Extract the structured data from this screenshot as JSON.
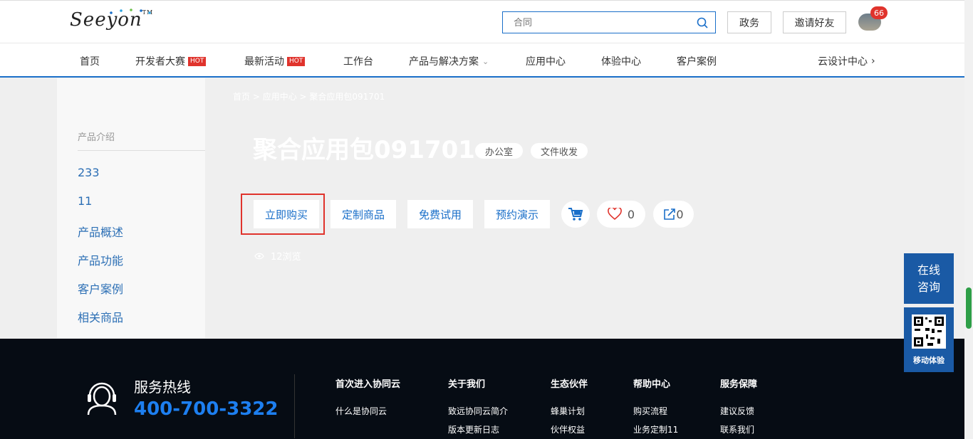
{
  "header": {
    "logo_text": "Seeyon",
    "logo_tm": "TM",
    "search_placeholder": "合同",
    "gov_button": "政务",
    "invite_button": "邀请好友",
    "notification_count": "66"
  },
  "nav": {
    "items": [
      {
        "label": "首页"
      },
      {
        "label": "开发者大赛",
        "badge": "HOT"
      },
      {
        "label": "最新活动",
        "badge": "HOT"
      },
      {
        "label": "工作台"
      },
      {
        "label": "产品与解决方案"
      },
      {
        "label": "应用中心"
      },
      {
        "label": "体验中心"
      },
      {
        "label": "客户案例"
      },
      {
        "label": "云设计中心"
      }
    ]
  },
  "sidebar": {
    "heading": "产品介绍",
    "items": [
      "233",
      "11",
      "产品概述",
      "产品功能",
      "客户案例",
      "相关商品"
    ]
  },
  "main": {
    "breadcrumb": [
      "首页",
      "应用中心",
      "聚合应用包091701"
    ],
    "title": "聚合应用包091701",
    "tags": [
      "办公室",
      "文件收发"
    ],
    "actions": {
      "buy": "立即购买",
      "custom": "定制商品",
      "trial": "免费试用",
      "demo": "预约演示"
    },
    "like_count": "0",
    "share_count": "0",
    "views": "12浏览"
  },
  "footer": {
    "hotline_label": "服务热线",
    "hotline_number": "400-700-3322",
    "columns": [
      {
        "title": "首次进入协同云",
        "links": [
          "什么是协同云"
        ]
      },
      {
        "title": "关于我们",
        "links": [
          "致远协同云简介",
          "版本更新日志"
        ]
      },
      {
        "title": "生态伙伴",
        "links": [
          "蜂巢计划",
          "伙伴权益"
        ]
      },
      {
        "title": "帮助中心",
        "links": [
          "购买流程",
          "业务定制11"
        ]
      },
      {
        "title": "服务保障",
        "links": [
          "建议反馈",
          "联系我们"
        ]
      }
    ]
  },
  "floating": {
    "consult": "在线咨询",
    "mobile": "移动体验"
  },
  "colors": {
    "brand_blue": "#1a6fc9",
    "hot_red": "#e0332c",
    "footer_bg": "#060c14"
  }
}
